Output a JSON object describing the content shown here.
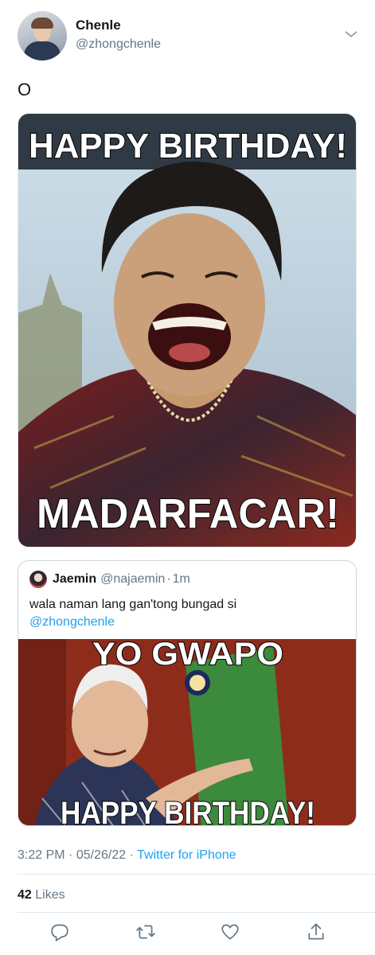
{
  "author": {
    "name": "Chenle",
    "handle": "@zhongchenle"
  },
  "tweet": {
    "text": "O",
    "image": {
      "caption_top": "HAPPY BIRTHDAY!",
      "caption_bottom": "MADARFACAR!"
    }
  },
  "quoted_tweet": {
    "name": "Jaemin",
    "handle": "@najaemin",
    "separator": "·",
    "time": "1m",
    "text": "wala naman lang gan'tong bungad si",
    "mention": "@zhongchenle",
    "image": {
      "caption_top": "YO GWAPO",
      "caption_bottom": "HAPPY BIRTHDAY!"
    }
  },
  "meta": {
    "time": "3:22 PM",
    "dot1": "·",
    "date": "05/26/22",
    "dot2": "·",
    "source": "Twitter for iPhone"
  },
  "stats": {
    "likes_count": "42",
    "likes_label": "Likes"
  },
  "actions": [
    "reply-icon",
    "retweet-icon",
    "like-icon",
    "share-icon"
  ],
  "colors": {
    "link": "#1da1f2",
    "secondary_text": "#657786",
    "divider": "#e1e8ed"
  }
}
